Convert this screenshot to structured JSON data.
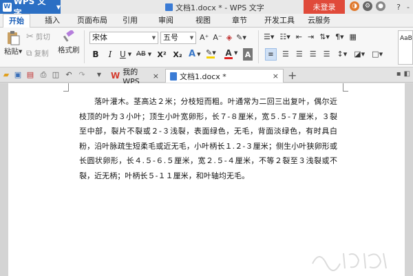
{
  "titlebar": {
    "app_name": "WPS 文字",
    "document_title": "文档1.docx * - WPS 文字",
    "login_label": "未登录",
    "window_buttons": [
      "?",
      "-"
    ]
  },
  "menu": {
    "tabs": [
      "开始",
      "插入",
      "页面布局",
      "引用",
      "审阅",
      "视图",
      "章节",
      "开发工具",
      "云服务"
    ]
  },
  "ribbon": {
    "cut": "剪切",
    "copy": "复制",
    "format_painter": "格式刷",
    "paste": "粘贴",
    "font_name": "宋体",
    "font_size": "五号",
    "bold": "B",
    "italic": "I",
    "underline": "U",
    "strike": "AB",
    "superscript": "X²",
    "subscript": "X₂",
    "font_color_letter": "A",
    "style_preview": "AaBb"
  },
  "colors": {
    "accent": "#2b6fc4",
    "login": "#e04a3a",
    "font_color": "#e02020",
    "highlight": "#f5d100"
  },
  "tabs_bar": {
    "wps_tab": "我的WPS",
    "doc_tab": "文档1.docx *",
    "close": "×",
    "add": "+"
  },
  "document": {
    "paragraph": "落叶灌木。茎高达２米；分枝短而粗。叶通常为二回三出复叶，偶尔近枝顶的叶为３小叶；顶生小叶宽卵形，长７-８厘米，宽５.５-７厘米，３裂至中部，裂片不裂或２-３浅裂，表面绿色，无毛，背面淡绿色，有时具白粉，沿叶脉疏生短柔毛或近无毛，小叶柄长１.２-３厘米；侧生小叶狭卵形或长圆状卵形，长４.５-６.５厘米，宽２.５-４厘米，不等２裂至３浅裂或不裂，近无柄；叶柄长５-１１厘米，和叶轴均无毛。"
  }
}
